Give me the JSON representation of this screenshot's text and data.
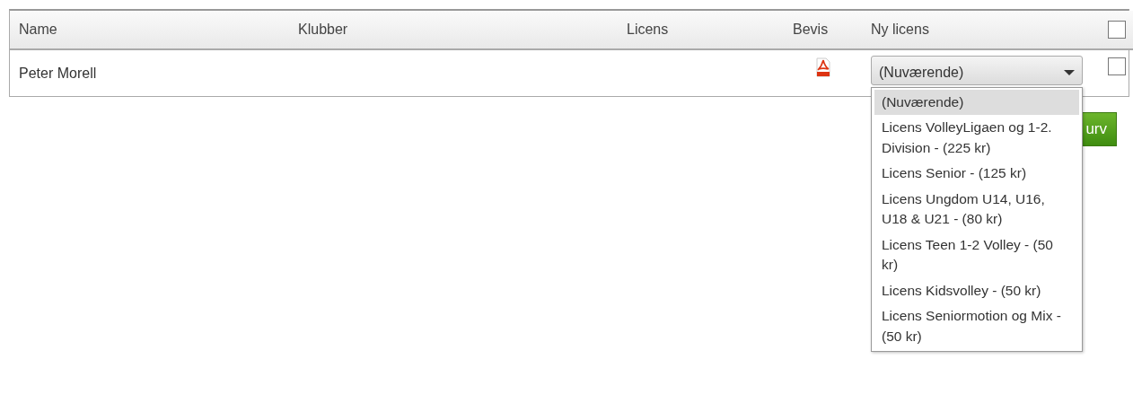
{
  "table": {
    "columns": [
      "Name",
      "Klubber",
      "Licens",
      "Bevis",
      "Ny licens"
    ],
    "header_checkbox": {
      "checked": false
    },
    "rows": [
      {
        "name": "Peter Morell",
        "bevis": {
          "kind": "pdf"
        },
        "checked": false,
        "ny_licens": {
          "value": "(Nuværende)",
          "expanded": true,
          "options": [
            {
              "label": "(Nuværende)",
              "selected": true
            },
            {
              "label": "Licens VolleyLigaen og 1-2. Division - (225 kr)",
              "selected": false
            },
            {
              "label": "Licens Senior - (125 kr)",
              "selected": false
            },
            {
              "label": "Licens Ungdom U14, U16, U18 & U21 - (80 kr)",
              "selected": false
            },
            {
              "label": "Licens Teen 1-2 Volley - (50 kr)",
              "selected": false
            },
            {
              "label": "Licens Kidsvolley - (50 kr)",
              "selected": false
            },
            {
              "label": "Licens Seniormotion og Mix - (50 kr)",
              "selected": false
            }
          ]
        }
      }
    ]
  },
  "button": {
    "label": "urv"
  }
}
